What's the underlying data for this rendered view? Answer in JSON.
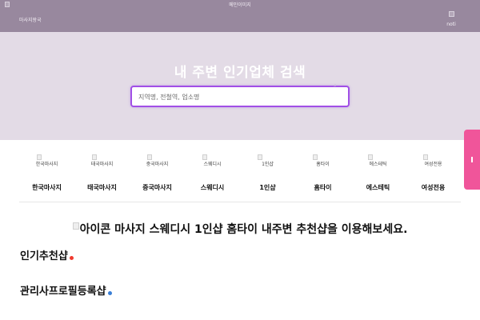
{
  "header": {
    "logo_text": "마사지왕국",
    "main_image_alt": "메인이미지",
    "noti_label": "noti"
  },
  "hero": {
    "title": "내 주변 인기업체 검색",
    "search_placeholder": "지역명, 전철역, 업소명"
  },
  "categories": [
    {
      "alt": "한국마사지",
      "label": "한국마사지"
    },
    {
      "alt": "태국마사지",
      "label": "태국마사지"
    },
    {
      "alt": "중국마사지",
      "label": "중국마사지"
    },
    {
      "alt": "스웨디시",
      "label": "스웨디시"
    },
    {
      "alt": "1인샵",
      "label": "1인샵"
    },
    {
      "alt": "홈타이",
      "label": "홈타이"
    },
    {
      "alt": "에스테틱",
      "label": "에스테틱"
    },
    {
      "alt": "여성전용",
      "label": "여성전용"
    }
  ],
  "banner": {
    "icon_alt": "아이콘",
    "text": " 마사지 스웨디시 1인샵 홈타이 내주변 추천샵을 이용해보세요."
  },
  "sections": {
    "popular": {
      "title": "인기추천샵",
      "dot_color": "#f03a2e"
    },
    "managers": {
      "title": "관리사프로필등록샵",
      "dot_color": "#3a7fd6"
    }
  },
  "colors": {
    "header_bg": "#98889e",
    "hero_bg": "#e3dbe6",
    "search_border": "#a14fe6",
    "side_tab": "#f0559a"
  }
}
